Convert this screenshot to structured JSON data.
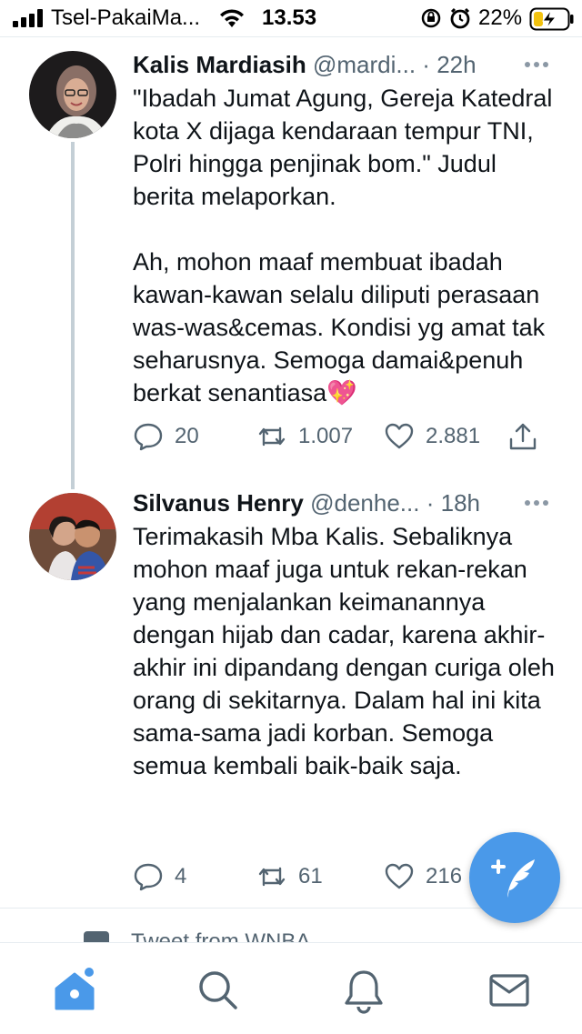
{
  "status_bar": {
    "carrier": "Tsel-PakaiMa...",
    "time": "13.53",
    "battery": "22%"
  },
  "tweets": [
    {
      "name": "Kalis Mardiasih",
      "handle": "@mardi...",
      "sep": "·",
      "ago": "22h",
      "paragraphs": [
        "\"Ibadah Jumat Agung, Gereja Katedral kota X dijaga kendaraan tempur TNI, Polri hingga penjinak bom.\" Judul berita melaporkan.",
        "Ah, mohon maaf membuat ibadah kawan-kawan selalu diliputi perasaan was-was&cemas. Kondisi yg amat tak seharusnya. Semoga damai&penuh berkat senantiasa💖"
      ],
      "replies": "20",
      "retweets": "1.007",
      "likes": "2.881"
    },
    {
      "name": "Silvanus Henry",
      "handle": "@denhe...",
      "sep": "·",
      "ago": "18h",
      "paragraphs": [
        "Terimakasih Mba Kalis. Sebaliknya mohon maaf juga untuk rekan-rekan yang menjalankan keimanannya dengan hijab dan cadar, karena akhir-akhir ini dipandang dengan curiga oleh orang di sekitarnya. Dalam hal ini kita sama-sama jadi korban. Semoga semua kembali baik-baik saja."
      ],
      "replies": "4",
      "retweets": "61",
      "likes": "216"
    }
  ],
  "peek": {
    "text": "Tweet from WNBA"
  },
  "colors": {
    "accent": "#4a99e9",
    "muted": "#536471",
    "divider": "#e6ecf0"
  },
  "icons": {
    "compose": "compose-tweet-icon",
    "nav": [
      "home-icon",
      "search-icon",
      "notifications-icon",
      "messages-icon"
    ]
  }
}
